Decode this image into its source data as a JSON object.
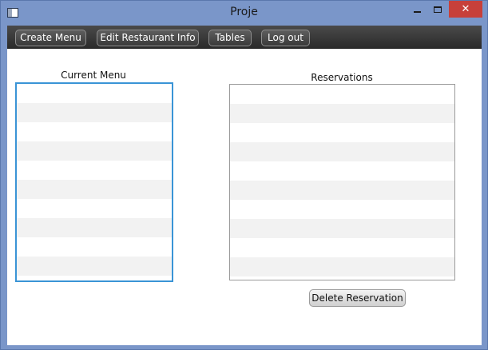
{
  "window": {
    "title": "Proje",
    "close_symbol": "✕",
    "icons": [
      "app-window-icon",
      "minimize-icon",
      "maximize-icon",
      "close-icon"
    ]
  },
  "toolbar": {
    "create_menu_label": "Create Menu",
    "edit_restaurant_info_label": "Edit Restaurant Info",
    "tables_label": "Tables",
    "log_out_label": "Log out"
  },
  "menu_panel": {
    "title": "Current Menu",
    "items": []
  },
  "reservations_panel": {
    "title": "Reservations",
    "items": [],
    "delete_label": "Delete Reservation"
  },
  "colors": {
    "window_frame": "#7a96c9",
    "toolbar": "#2b2b2b",
    "close_button": "#c7403a",
    "focus_border": "#3a94d6",
    "row_stripe": "#f2f2f2"
  }
}
